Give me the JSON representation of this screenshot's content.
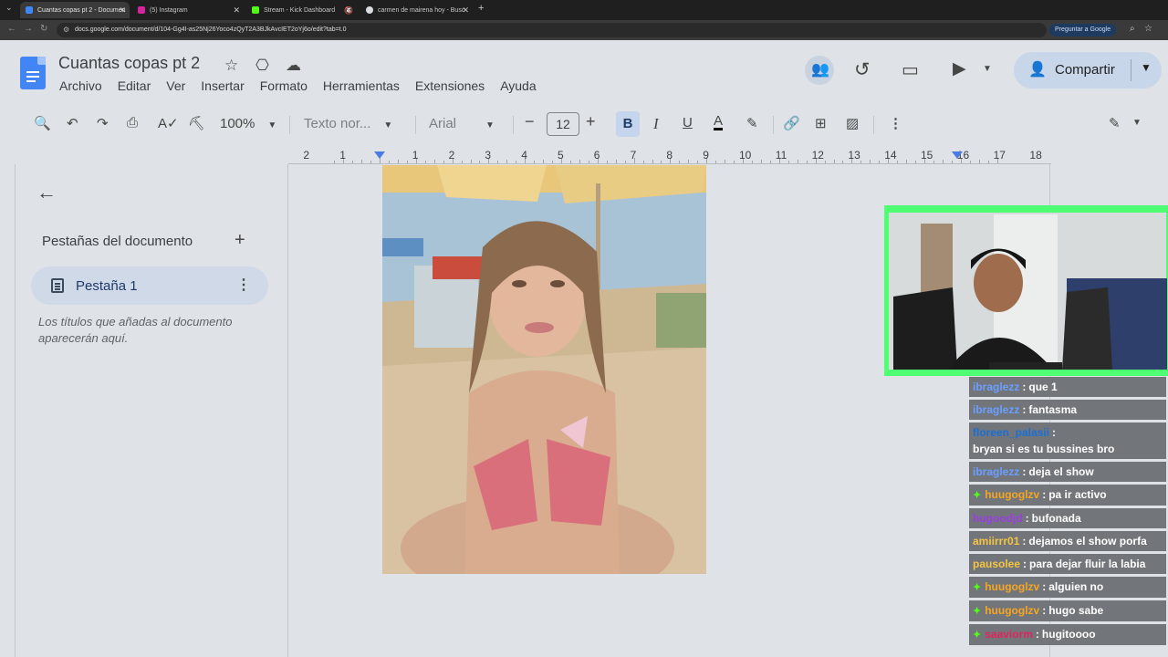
{
  "browser": {
    "tabs": [
      {
        "title": "Cuantas copas pt 2 - Documen",
        "active": true,
        "favicon_color": "#4285f4"
      },
      {
        "title": "(5) Instagram",
        "active": false,
        "favicon_color": "#d6249f"
      },
      {
        "title": "Stream - Kick Dashboard",
        "active": false,
        "favicon_color": "#53fc18"
      },
      {
        "title": "carmen de mairena hoy - Busc",
        "active": false,
        "favicon_color": "#dadce0"
      }
    ],
    "url": "docs.google.com/document/d/104-Gg4I-as25Nj26Yoco4zQyT2A3BJkAvcIET2oYj6o/edit?tab=t.0",
    "ask_google": "Preguntar a Google"
  },
  "docs": {
    "title": "Cuantas copas pt 2",
    "menu": [
      "Archivo",
      "Editar",
      "Ver",
      "Insertar",
      "Formato",
      "Herramientas",
      "Extensiones",
      "Ayuda"
    ],
    "share_label": "Compartir"
  },
  "toolbar": {
    "zoom": "100%",
    "style": "Texto nor...",
    "font": "Arial",
    "font_size": "12"
  },
  "ruler": {
    "labels": [
      "2",
      "1",
      "",
      "1",
      "2",
      "3",
      "4",
      "5",
      "6",
      "7",
      "8",
      "9",
      "10",
      "11",
      "12",
      "13",
      "14",
      "15",
      "16",
      "17",
      "18"
    ]
  },
  "sidebar": {
    "heading": "Pestañas del documento",
    "tab_label": "Pestaña 1",
    "hint": "Los títulos que añadas al documento aparecerán aquí."
  },
  "chat": {
    "messages": [
      {
        "user": "ibraglezz",
        "text": "que 1",
        "color": "#6b9fff",
        "badge": false
      },
      {
        "user": "ibraglezz",
        "text": "fantasma",
        "color": "#6b9fff",
        "badge": false
      },
      {
        "user": "floreen_palasii",
        "text": "bryan si es tu bussines bro",
        "color": "#1a6fd6",
        "badge": false
      },
      {
        "user": "ibraglezz",
        "text": "deja el show",
        "color": "#6b9fff",
        "badge": false
      },
      {
        "user": "huugoglzv",
        "text": "pa ir activo",
        "color": "#f5a623",
        "badge": true
      },
      {
        "user": "hugoodjd",
        "text": "bufonada",
        "color": "#9b3de0",
        "badge": false
      },
      {
        "user": "amiirrr01",
        "text": "dejamos el show porfa",
        "color": "#f5c542",
        "badge": false
      },
      {
        "user": "pausolee",
        "text": "para dejar fluir la labia",
        "color": "#f5c542",
        "badge": false
      },
      {
        "user": "huugoglzv",
        "text": "alguien no",
        "color": "#f5a623",
        "badge": true
      },
      {
        "user": "huugoglzv",
        "text": "hugo sabe",
        "color": "#f5a623",
        "badge": true
      },
      {
        "user": "saaviorm",
        "text": "hugitoooo",
        "color": "#e0245e",
        "badge": true
      }
    ]
  }
}
